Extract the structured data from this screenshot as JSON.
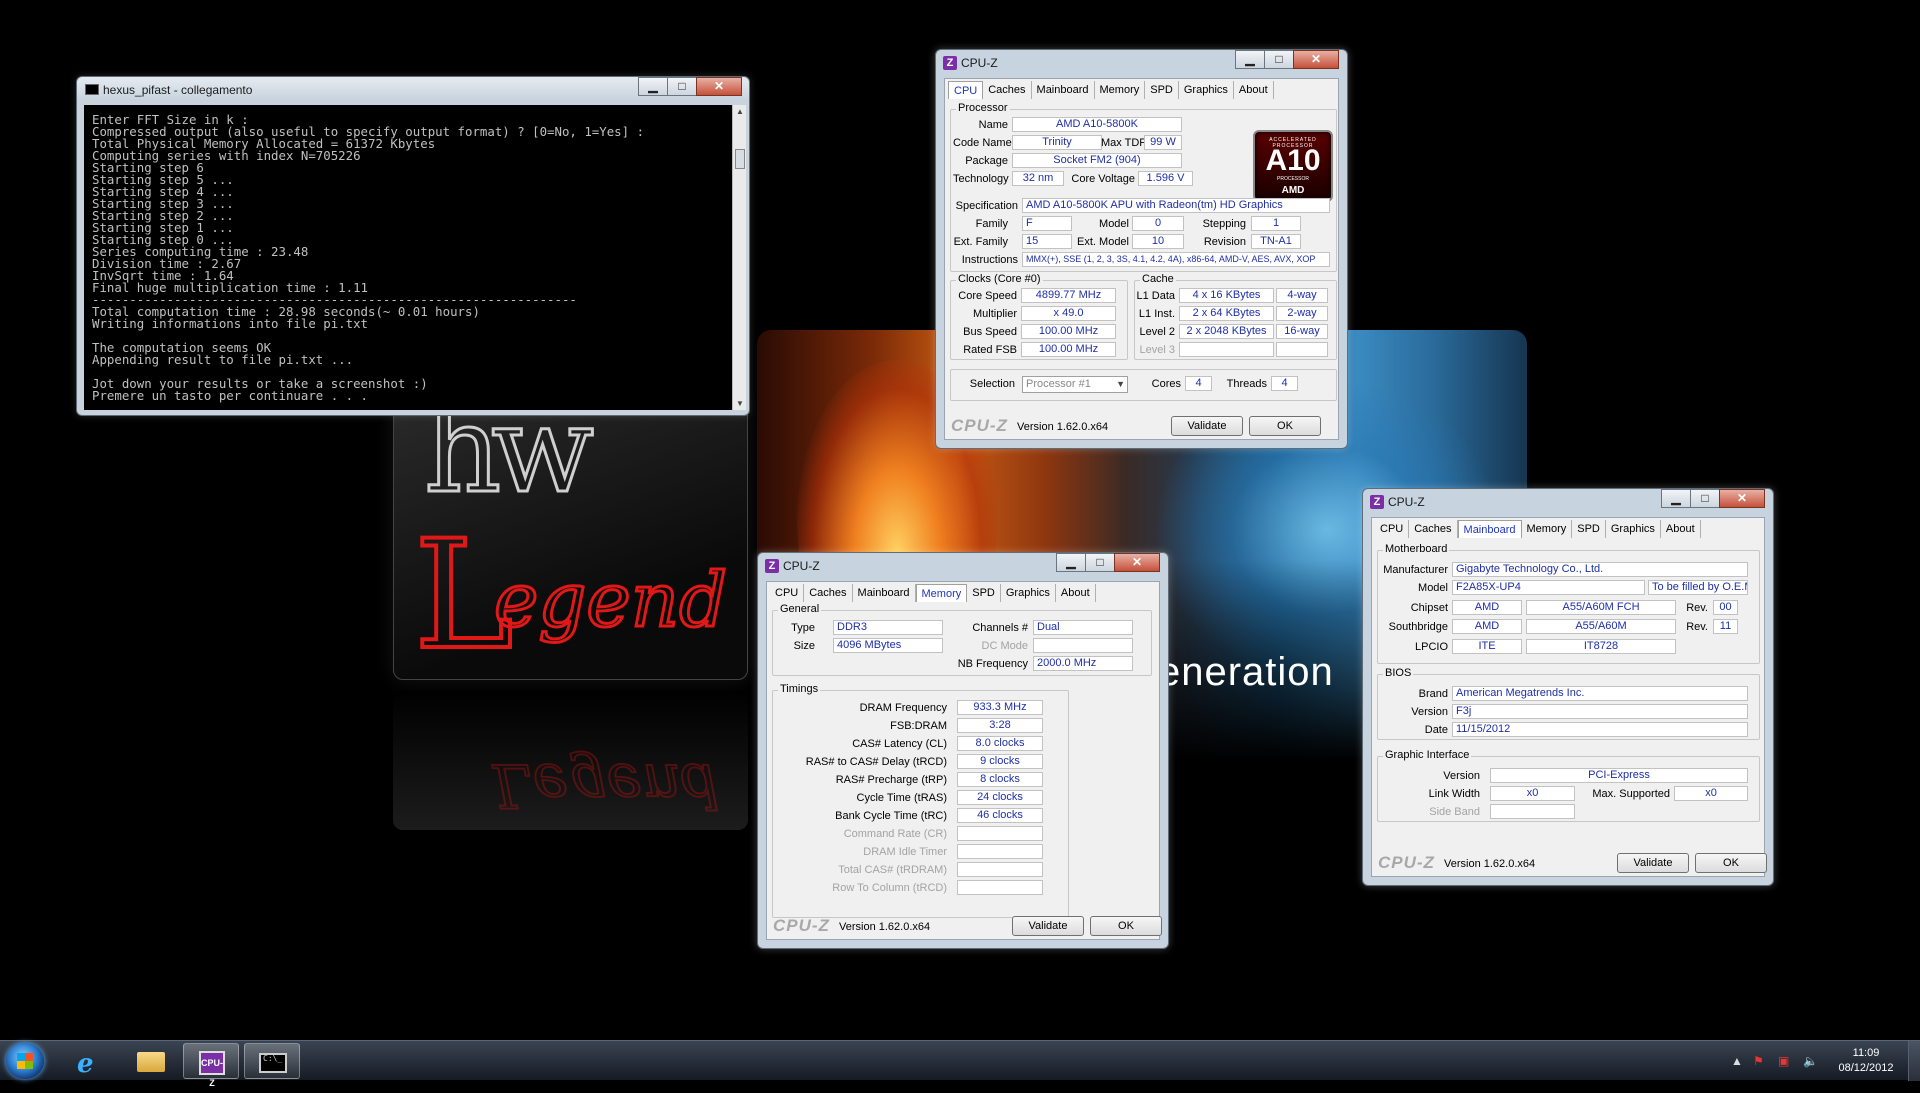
{
  "wallpaper": {
    "tagline": "eneration"
  },
  "console": {
    "title": "hexus_pifast - collegamento",
    "lines": [
      "Enter FFT Size in k :",
      "Compressed output (also useful to specify output format) ? [0=No, 1=Yes] :",
      "Total Physical Memory Allocated = 61372 Kbytes",
      "Computing series with index N=705226",
      "Starting step 6",
      "Starting step 5 ...",
      "Starting step 4 ...",
      "Starting step 3 ...",
      "Starting step 2 ...",
      "Starting step 1 ...",
      "Starting step 0 ...",
      "Series computing time : 23.48",
      "Division time : 2.67",
      "InvSqrt time : 1.64",
      "Final huge multiplication time : 1.11",
      "-----------------------------------------------------------------",
      "Total computation time : 28.98 seconds(~ 0.01 hours)",
      "Writing informations into file pi.txt",
      "",
      "The computation seems OK",
      "Appending result to file pi.txt ...",
      "",
      "Jot down your results or take a screenshot :)",
      "Premere un tasto per continuare . . ."
    ]
  },
  "cpuz_common": {
    "tabs": [
      "CPU",
      "Caches",
      "Mainboard",
      "Memory",
      "SPD",
      "Graphics",
      "About"
    ],
    "brand": "CPU-Z",
    "version": "Version 1.62.0.x64",
    "validate": "Validate",
    "ok": "OK"
  },
  "cpu": {
    "title": "CPU-Z",
    "active_tab": "CPU",
    "processor_label": "Processor",
    "name_label": "Name",
    "name": "AMD A10-5800K",
    "codename_label": "Code Name",
    "codename": "Trinity",
    "maxtdp_label": "Max TDP",
    "maxtdp": "99 W",
    "package_label": "Package",
    "package": "Socket FM2 (904)",
    "tech_label": "Technology",
    "tech": "32 nm",
    "corev_label": "Core Voltage",
    "corev": "1.596 V",
    "spec_label": "Specification",
    "spec": "AMD A10-5800K APU with Radeon(tm) HD Graphics",
    "family_label": "Family",
    "family": "F",
    "model_label": "Model",
    "model": "0",
    "stepping_label": "Stepping",
    "stepping": "1",
    "extfamily_label": "Ext. Family",
    "extfamily": "15",
    "extmodel_label": "Ext. Model",
    "extmodel": "10",
    "revision_label": "Revision",
    "revision": "TN-A1",
    "instr_label": "Instructions",
    "instr": "MMX(+), SSE (1, 2, 3, 3S, 4.1, 4.2, 4A), x86-64, AMD-V, AES, AVX, XOP",
    "badge": {
      "top": "ACCELERATED PROCESSOR",
      "big": "A10",
      "sub": "PROCESSOR",
      "vendor": "AMD"
    },
    "clocks_label": "Clocks (Core #0)",
    "corespeed_label": "Core Speed",
    "corespeed": "4899.77 MHz",
    "mult_label": "Multiplier",
    "mult": "x 49.0",
    "bus_label": "Bus Speed",
    "bus": "100.00 MHz",
    "fsb_label": "Rated FSB",
    "fsb": "100.00 MHz",
    "cache_label": "Cache",
    "l1d_label": "L1 Data",
    "l1d": "4 x 16 KBytes",
    "l1d_way": "4-way",
    "l1i_label": "L1 Inst.",
    "l1i": "2 x 64 KBytes",
    "l1i_way": "2-way",
    "l2_label": "Level 2",
    "l2": "2 x 2048 KBytes",
    "l2_way": "16-way",
    "l3_label": "Level 3",
    "selection_label": "Selection",
    "selection": "Processor #1",
    "cores_label": "Cores",
    "cores": "4",
    "threads_label": "Threads",
    "threads": "4"
  },
  "memory": {
    "title": "CPU-Z",
    "active_tab": "Memory",
    "general_label": "General",
    "type_label": "Type",
    "type": "DDR3",
    "size_label": "Size",
    "size": "4096 MBytes",
    "channels_label": "Channels #",
    "channels": "Dual",
    "dcmode_label": "DC Mode",
    "nbfreq_label": "NB Frequency",
    "nbfreq": "2000.0 MHz",
    "timings_label": "Timings",
    "timings": [
      {
        "label": "DRAM Frequency",
        "value": "933.3 MHz"
      },
      {
        "label": "FSB:DRAM",
        "value": "3:28"
      },
      {
        "label": "CAS# Latency (CL)",
        "value": "8.0 clocks"
      },
      {
        "label": "RAS# to CAS# Delay (tRCD)",
        "value": "9 clocks"
      },
      {
        "label": "RAS# Precharge (tRP)",
        "value": "8 clocks"
      },
      {
        "label": "Cycle Time (tRAS)",
        "value": "24 clocks"
      },
      {
        "label": "Bank Cycle Time (tRC)",
        "value": "46 clocks"
      },
      {
        "label": "Command Rate (CR)",
        "value": ""
      },
      {
        "label": "DRAM Idle Timer",
        "value": ""
      },
      {
        "label": "Total CAS# (tRDRAM)",
        "value": ""
      },
      {
        "label": "Row To Column (tRCD)",
        "value": ""
      }
    ]
  },
  "mainboard": {
    "title": "CPU-Z",
    "active_tab": "Mainboard",
    "mb_label": "Motherboard",
    "manufacturer_label": "Manufacturer",
    "manufacturer": "Gigabyte Technology Co., Ltd.",
    "model_label": "Model",
    "model": "F2A85X-UP4",
    "model_rev": "To be filled by O.E.M.",
    "chipset_label": "Chipset",
    "chipset_vendor": "AMD",
    "chipset": "A55/A60M FCH",
    "chipset_rev_label": "Rev.",
    "chipset_rev": "00",
    "south_label": "Southbridge",
    "south_vendor": "AMD",
    "south": "A55/A60M",
    "south_rev_label": "Rev.",
    "south_rev": "11",
    "lpcio_label": "LPCIO",
    "lpcio_vendor": "ITE",
    "lpcio": "IT8728",
    "bios_label": "BIOS",
    "brand_label": "Brand",
    "brand": "American Megatrends Inc.",
    "version_label": "Version",
    "version": "F3j",
    "date_label": "Date",
    "date": "11/15/2012",
    "gi_label": "Graphic Interface",
    "gi_version_label": "Version",
    "gi_version": "PCI-Express",
    "linkwidth_label": "Link Width",
    "linkwidth": "x0",
    "maxsup_label": "Max. Supported",
    "maxsup": "x0",
    "sideband_label": "Side Band"
  },
  "taskbar": {
    "time": "11:09",
    "date": "08/12/2012",
    "cpuz_icon_text": "CPU-Z",
    "cmd_icon_text": "C:\\_"
  }
}
